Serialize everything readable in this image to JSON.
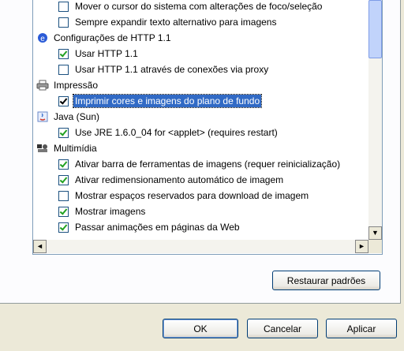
{
  "dialog": {
    "restore_button": "Restaurar padrões",
    "ok_button": "OK",
    "cancel_button": "Cancelar",
    "apply_button": "Aplicar"
  },
  "settings": [
    {
      "type": "option",
      "label": "Mover o cursor do sistema com alterações de foco/seleção",
      "checked": false
    },
    {
      "type": "option",
      "label": "Sempre expandir texto alternativo para imagens",
      "checked": false
    },
    {
      "type": "group",
      "label": "Configurações de HTTP 1.1",
      "icon": "http-settings-icon"
    },
    {
      "type": "option",
      "label": "Usar HTTP 1.1",
      "checked": true
    },
    {
      "type": "option",
      "label": "Usar HTTP 1.1 através de conexões via proxy",
      "checked": false
    },
    {
      "type": "group",
      "label": "Impressão",
      "icon": "printer-icon"
    },
    {
      "type": "option",
      "label": "Imprimir cores e imagens do plano de fundo",
      "checked": true,
      "selected": true
    },
    {
      "type": "group",
      "label": "Java (Sun)",
      "icon": "java-icon"
    },
    {
      "type": "option",
      "label": "Use JRE 1.6.0_04 for <applet> (requires restart)",
      "checked": true
    },
    {
      "type": "group",
      "label": "Multimídia",
      "icon": "multimedia-icon"
    },
    {
      "type": "option",
      "label": "Ativar barra de ferramentas de imagens (requer reinicialização)",
      "checked": true
    },
    {
      "type": "option",
      "label": "Ativar redimensionamento automático de imagem",
      "checked": true
    },
    {
      "type": "option",
      "label": "Mostrar espaços reservados para download de imagem",
      "checked": false
    },
    {
      "type": "option",
      "label": "Mostrar imagens",
      "checked": true
    },
    {
      "type": "option",
      "label": "Passar animações em páginas da Web",
      "checked": true
    }
  ],
  "scroll": {
    "up": "▲",
    "down": "▼",
    "left": "◄",
    "right": "►"
  }
}
